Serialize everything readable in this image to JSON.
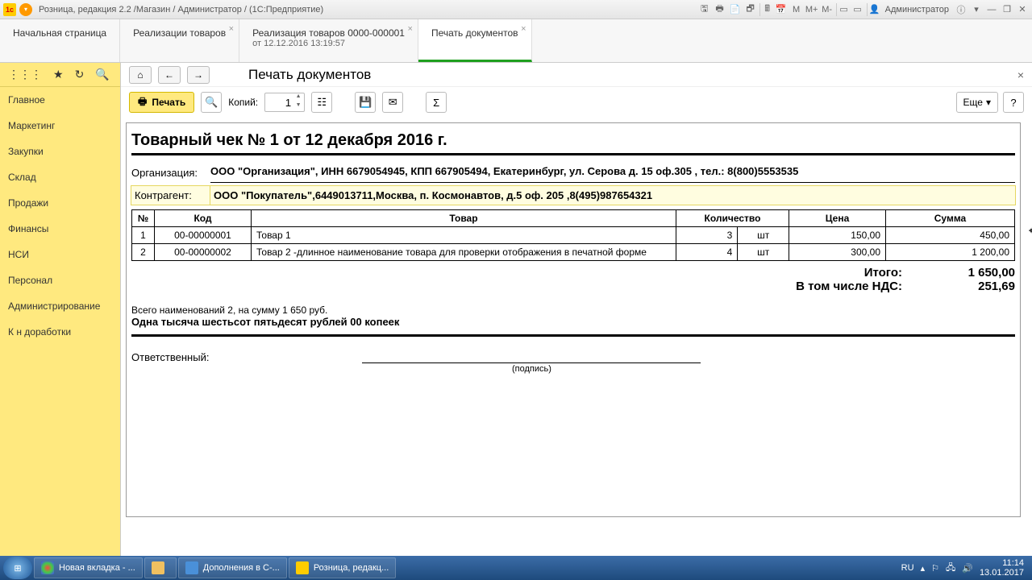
{
  "titlebar": {
    "title": "Розница, редакция 2.2 /Магазин / Администратор /  (1С:Предприятие)",
    "user": "Администратор",
    "m_labels": [
      "М",
      "М+",
      "М-"
    ]
  },
  "tabs": [
    {
      "label": "Начальная страница"
    },
    {
      "label": "Реализации товаров",
      "closable": true
    },
    {
      "label": "Реализация товаров 0000-000001",
      "sub": "от 12.12.2016 13:19:57",
      "closable": true
    },
    {
      "label": "Печать документов",
      "closable": true,
      "active": true
    }
  ],
  "sidebar": {
    "items": [
      "Главное",
      "Маркетинг",
      "Закупки",
      "Склад",
      "Продажи",
      "Финансы",
      "НСИ",
      "Персонал",
      "Администрирование",
      "К н доработки"
    ]
  },
  "page": {
    "title": "Печать документов",
    "print_label": "Печать",
    "copies_label": "Копий:",
    "copies_value": "1",
    "more_label": "Еще",
    "help_label": "?"
  },
  "doc": {
    "heading": "Товарный чек № 1 от 12 декабря 2016 г.",
    "org_label": "Организация:",
    "org_value": "ООО \"Организация\", ИНН 6679054945, КПП 667905494, Екатеринбург, ул. Серова д. 15 оф.305 , тел.: 8(800)5553535",
    "contr_label": "Контрагент:",
    "contr_value": "ООО \"Покупатель\",6449013711,Москва, п. Космонавтов, д.5 оф. 205 ,8(495)987654321",
    "columns": [
      "№",
      "Код",
      "Товар",
      "Количество",
      "Цена",
      "Сумма"
    ],
    "rows": [
      {
        "n": "1",
        "code": "00-00000001",
        "name": "Товар 1",
        "qty": "3",
        "unit": "шт",
        "price": "150,00",
        "sum": "450,00"
      },
      {
        "n": "2",
        "code": "00-00000002",
        "name": "Товар 2 -длинное наименование товара для проверки отображения в печатной форме",
        "qty": "4",
        "unit": "шт",
        "price": "300,00",
        "sum": "1 200,00"
      }
    ],
    "total_label": "Итого:",
    "total_value": "1 650,00",
    "vat_label": "В том числе НДС:",
    "vat_value": "251,69",
    "items_summary": "Всего наименований 2, на сумму 1 650 руб.",
    "amount_words": "Одна тысяча шестьсот пятьдесят рублей 00 копеек",
    "resp_label": "Ответственный:",
    "sig_label": "(подпись)"
  },
  "taskbar": {
    "items": [
      {
        "label": "Новая вкладка - ...",
        "color": "#ffcc00"
      },
      {
        "label": "",
        "color": "#f0c060",
        "icon_only": true
      },
      {
        "label": "Дополнения в С-...",
        "color": "#4a90d9"
      },
      {
        "label": "Розница, редакц...",
        "color": "#ffcc00"
      }
    ],
    "lang": "RU",
    "time": "11:14",
    "date": "13.01.2017"
  }
}
